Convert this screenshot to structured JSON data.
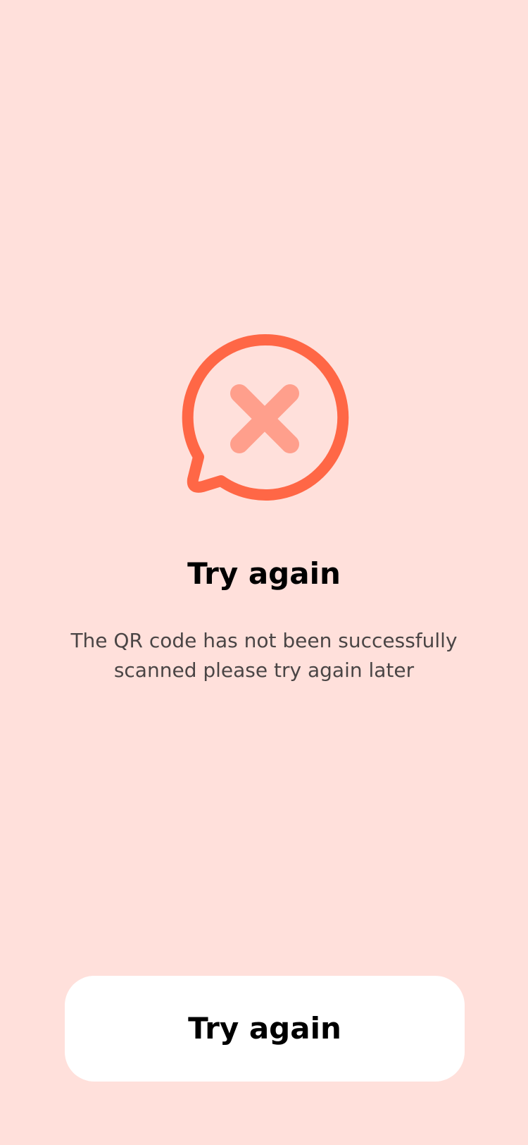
{
  "screen": {
    "title": "Try again",
    "message": "The QR code has not been successfully scanned please try again later",
    "icon": "chat-bubble-x-icon",
    "colors": {
      "background": "#FFE0DB",
      "icon_primary": "#FF6746",
      "icon_secondary": "#FF9F8C",
      "title": "#000000",
      "message": "#4A4545",
      "button_bg": "#FFFFFF"
    }
  },
  "actions": {
    "retry_label": "Try again"
  }
}
